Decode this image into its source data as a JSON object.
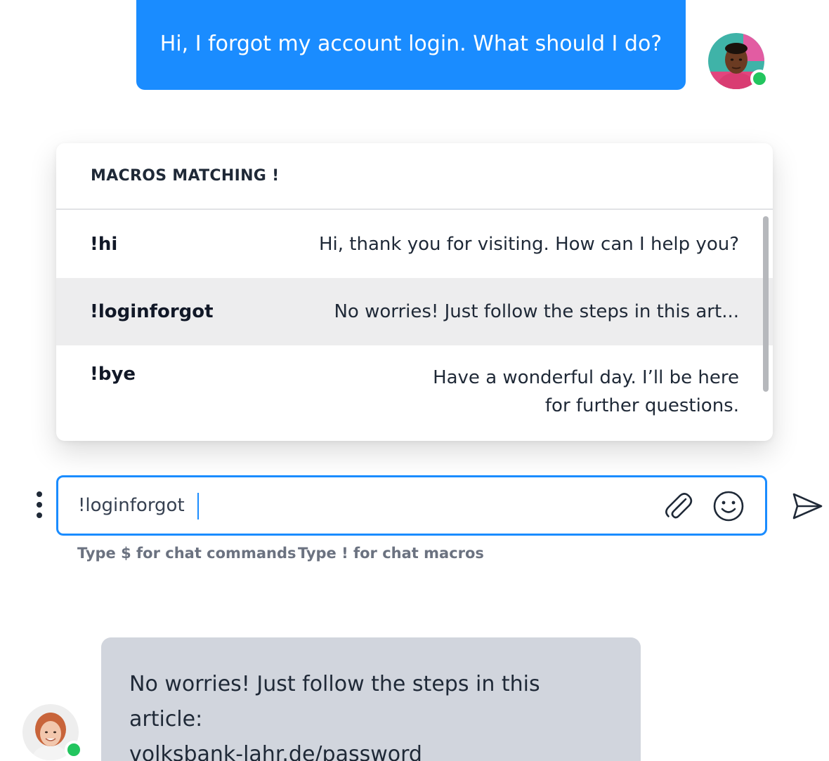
{
  "customer_message": {
    "text": "Hi, I forgot my account login. What should I do?",
    "avatar_icon": "customer-avatar",
    "status": "online"
  },
  "macro_panel": {
    "title": "MACROS MATCHING !",
    "items": [
      {
        "key": "!hi",
        "text": "Hi, thank you for visiting. How can I help you?",
        "active": false
      },
      {
        "key": "!loginforgot",
        "text": "No worries! Just follow the steps in this art...",
        "active": true
      },
      {
        "key": "!bye",
        "text_line1": "Have a wonderful day. I’ll be here",
        "text_line2": "for further questions.",
        "active": false
      }
    ]
  },
  "composer": {
    "value": "!loginforgot",
    "icons": [
      "more-vertical-icon",
      "paperclip-icon",
      "smiley-icon",
      "send-icon"
    ],
    "accent_color": "#1a8cff"
  },
  "hints": {
    "commands": "Type $ for chat commands",
    "macros": "Type ! for chat macros"
  },
  "agent_message": {
    "text": "No worries! Just follow the steps in this article:",
    "link": "volksbank-lahr.de/password",
    "avatar_icon": "agent-avatar",
    "status": "online"
  },
  "colors": {
    "customer_bubble": "#1a8cff",
    "agent_bubble": "#d1d5dd",
    "online": "#22c55e",
    "active_row": "#ededee"
  }
}
